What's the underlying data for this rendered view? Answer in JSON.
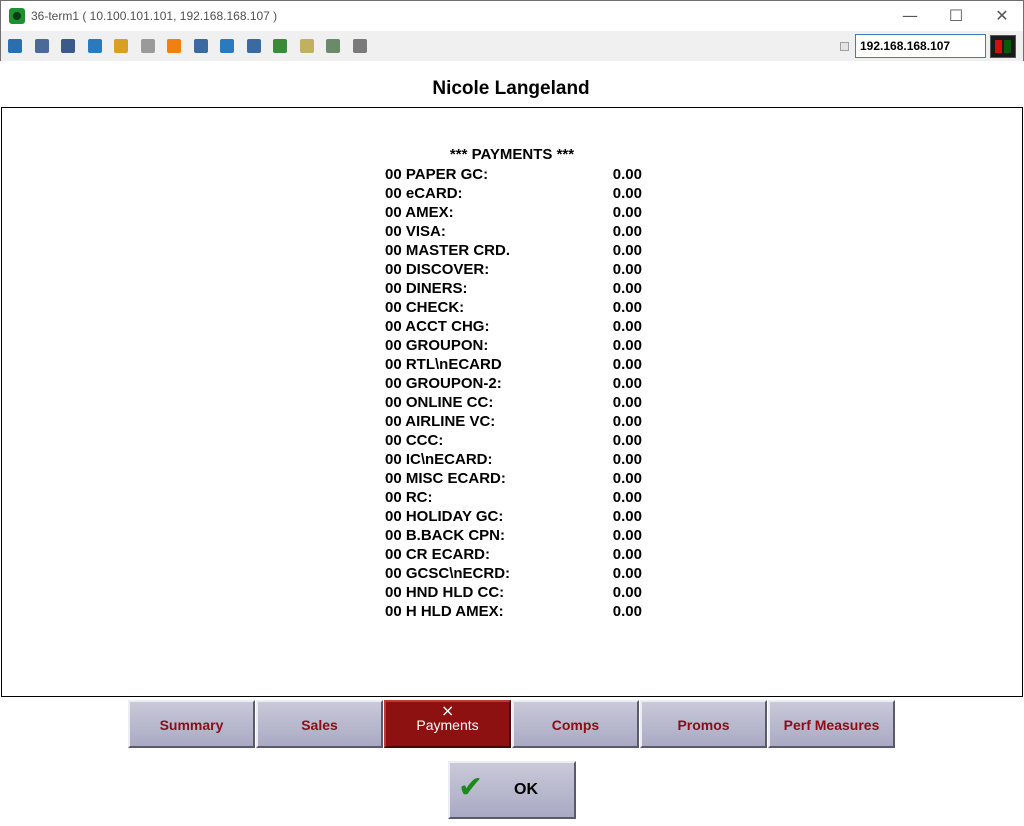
{
  "window": {
    "title": "36-term1 ( 10.100.101.101, 192.168.168.107 )",
    "controls": {
      "minimize": "—",
      "maximize": "☐",
      "close": "✕"
    }
  },
  "toolbar": {
    "icons": [
      {
        "name": "monitor-graph-icon",
        "color": "#2a6fb0"
      },
      {
        "name": "windows-stack-icon",
        "color": "#4a6a9a"
      },
      {
        "name": "tools-icon",
        "color": "#3a5a8a"
      },
      {
        "name": "refresh-icon",
        "color": "#2a7ac0"
      },
      {
        "name": "windows-logo-icon",
        "color": "#d8a020"
      },
      {
        "name": "keyboard-icon",
        "color": "#9a9a9a"
      },
      {
        "name": "alert-icon",
        "color": "#f08010"
      },
      {
        "name": "network-error-icon",
        "color": "#3a6aa0"
      },
      {
        "name": "fullscreen-icon",
        "color": "#2a7ac0"
      },
      {
        "name": "display-icon",
        "color": "#3a6aa0"
      },
      {
        "name": "download-icon",
        "color": "#3a8a3a"
      },
      {
        "name": "notepad-icon",
        "color": "#c0b060"
      },
      {
        "name": "screen-capture-icon",
        "color": "#6a8a6a"
      },
      {
        "name": "multi-screen-icon",
        "color": "#7a7a7a"
      }
    ],
    "ip_value": "192.168.168.107",
    "status_colors": {
      "left": "#d01010",
      "right": "#0a5a0a"
    }
  },
  "header": {
    "name": "Nicole Langeland"
  },
  "report": {
    "title": "*** PAYMENTS ***",
    "rows": [
      {
        "label": "00 PAPER GC:",
        "value": "0.00"
      },
      {
        "label": "00 eCARD:",
        "value": "0.00"
      },
      {
        "label": "00 AMEX:",
        "value": "0.00"
      },
      {
        "label": "00 VISA:",
        "value": "0.00"
      },
      {
        "label": "00 MASTER CRD.",
        "value": "0.00"
      },
      {
        "label": "00 DISCOVER:",
        "value": "0.00"
      },
      {
        "label": "00 DINERS:",
        "value": "0.00"
      },
      {
        "label": "00 CHECK:",
        "value": "0.00"
      },
      {
        "label": "00 ACCT CHG:",
        "value": "0.00"
      },
      {
        "label": "00 GROUPON:",
        "value": "0.00"
      },
      {
        "label": "00 RTL\\nECARD",
        "value": "0.00"
      },
      {
        "label": "00 GROUPON-2:",
        "value": "0.00"
      },
      {
        "label": "00 ONLINE CC:",
        "value": "0.00"
      },
      {
        "label": "00 AIRLINE VC:",
        "value": "0.00"
      },
      {
        "label": "00 CCC:",
        "value": "0.00"
      },
      {
        "label": "00 IC\\nECARD:",
        "value": "0.00"
      },
      {
        "label": "00 MISC ECARD:",
        "value": "0.00"
      },
      {
        "label": "00 RC:",
        "value": "0.00"
      },
      {
        "label": "00 HOLIDAY GC:",
        "value": "0.00"
      },
      {
        "label": "00 B.BACK CPN:",
        "value": "0.00"
      },
      {
        "label": "00 CR ECARD:",
        "value": "0.00"
      },
      {
        "label": "00 GCSC\\nECRD:",
        "value": "0.00"
      },
      {
        "label": "00 HND HLD CC:",
        "value": "0.00"
      },
      {
        "label": "00 H HLD AMEX:",
        "value": "0.00"
      }
    ]
  },
  "tabs": [
    {
      "label": "Summary",
      "active": false
    },
    {
      "label": "Sales",
      "active": false
    },
    {
      "label": "Payments",
      "active": true
    },
    {
      "label": "Comps",
      "active": false
    },
    {
      "label": "Promos",
      "active": false
    },
    {
      "label": "Perf Measures",
      "active": false
    }
  ],
  "ok_button": {
    "label": "OK",
    "icon": "checkmark-icon"
  }
}
